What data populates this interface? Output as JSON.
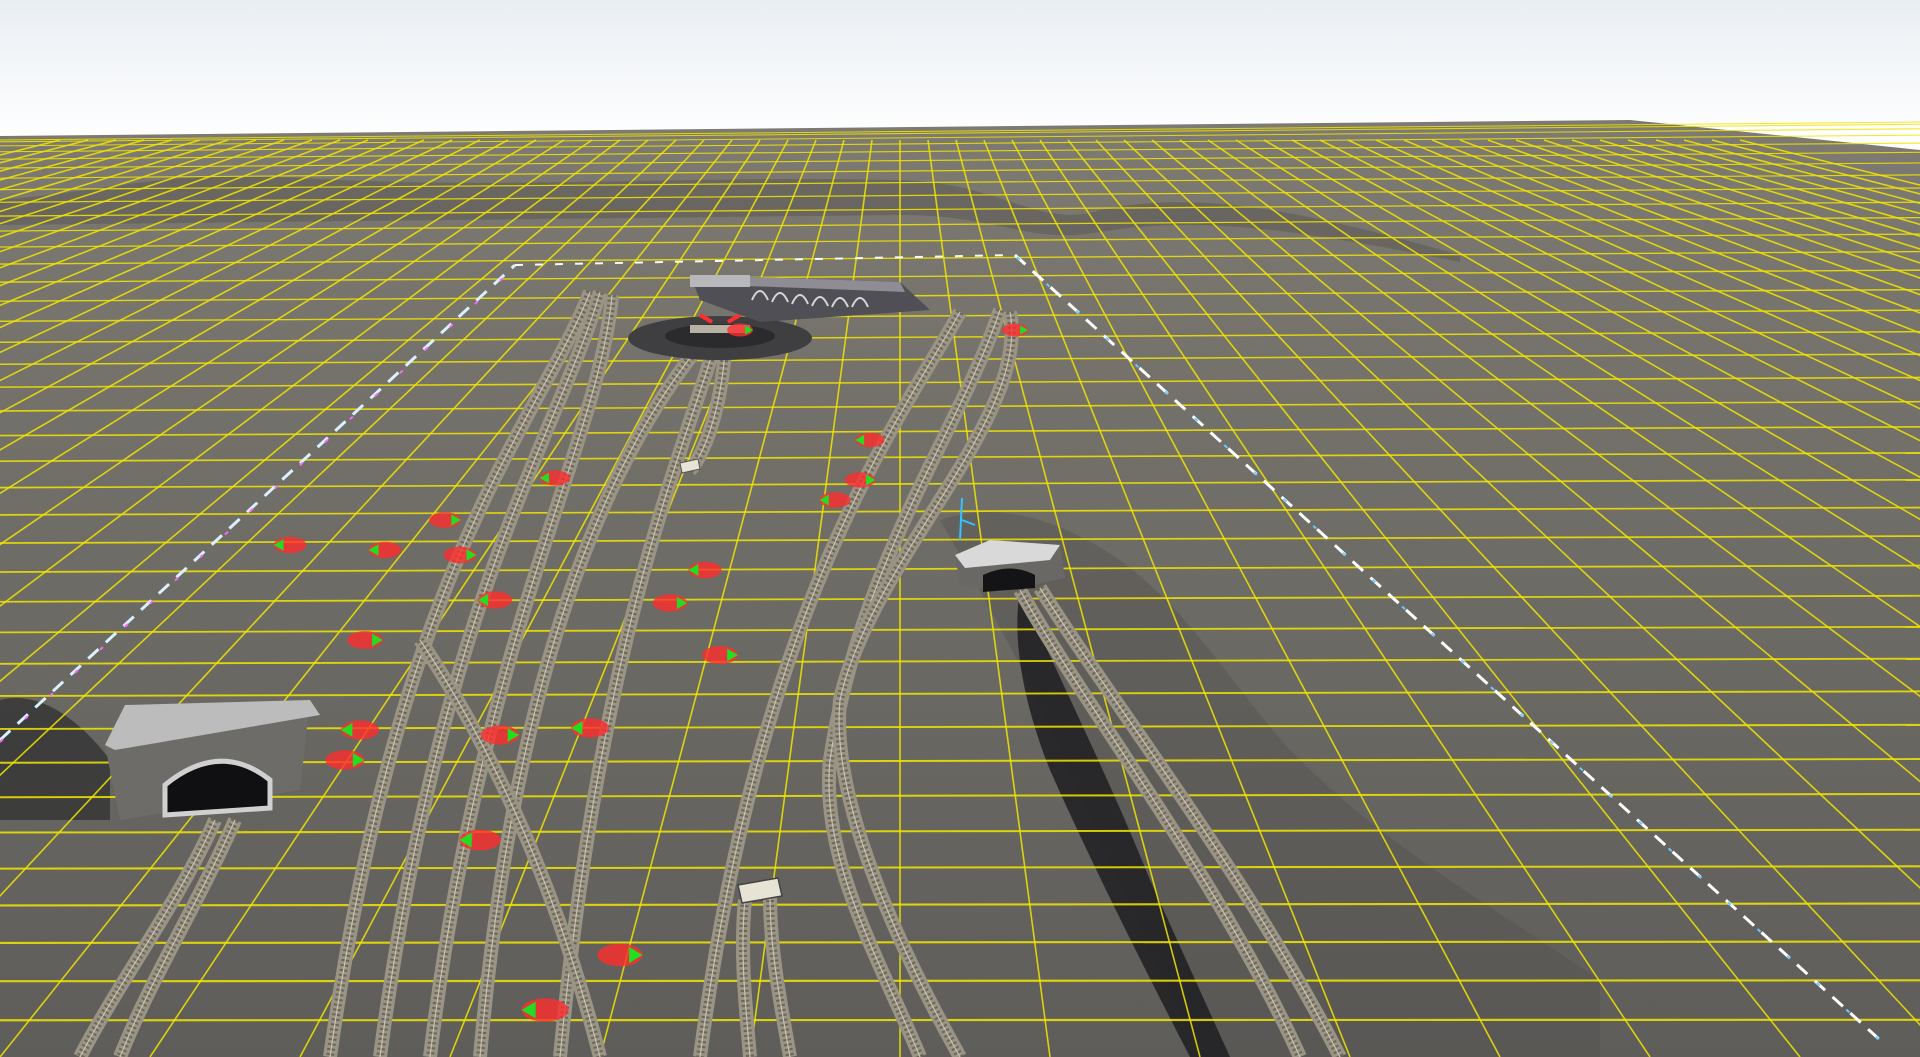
{
  "scene": {
    "type": "3d-model-railway-editor-viewport",
    "colors": {
      "sky_top": "#e9eef3",
      "sky_bottom": "#ffffff",
      "ground": "#6f6c66",
      "ground_dark": "#4f4d49",
      "grid_line": "#f2e600",
      "track_ballast": "#9a9485",
      "track_sleepers": "#6c6558",
      "rail": "#c9c3b3",
      "tunnel_stone": "#7a7873",
      "tunnel_roof": "#cfcfcf",
      "marker_red": "#ff2d2d",
      "marker_green": "#22dd22",
      "turntable": "#3f3f42",
      "roundhouse": "#58585d"
    },
    "objects": {
      "tunnel_left": "tunnel-portal",
      "tunnel_right": "tunnel-portal",
      "turntable": "turntable",
      "roundhouse": "roundhouse",
      "vehicles": [
        "railcar",
        "railcar"
      ],
      "switch_markers": 26
    }
  }
}
